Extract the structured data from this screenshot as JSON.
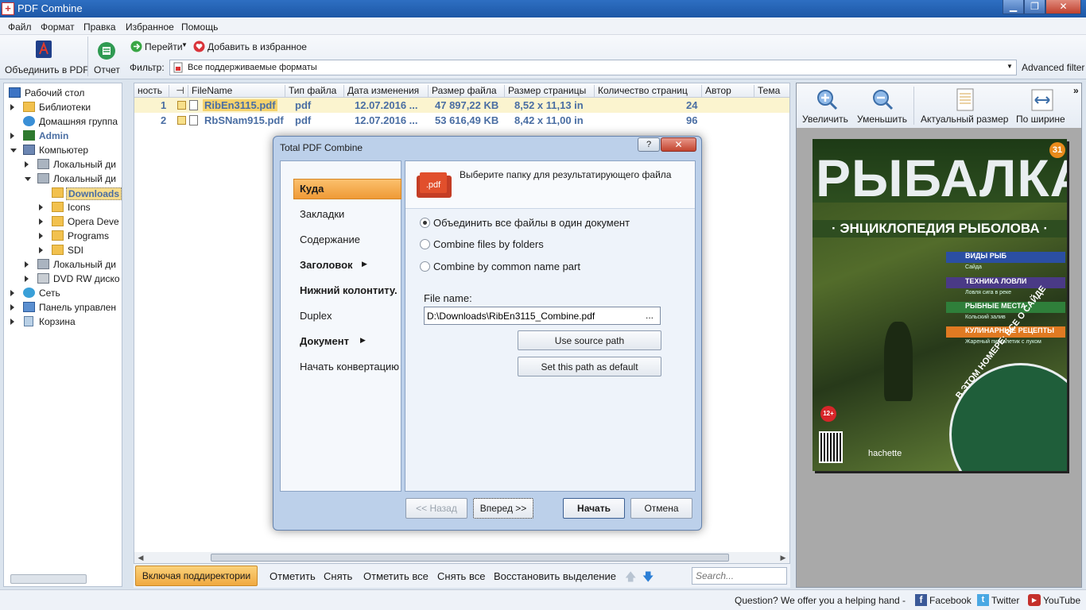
{
  "window": {
    "title": "PDF Combine"
  },
  "menu": [
    "Файл",
    "Формат",
    "Правка",
    "Избранное",
    "Помощь"
  ],
  "toolbar": {
    "combine_label": "Объединить в PDF",
    "report_label": "Отчет",
    "goto_label": "Перейти",
    "favorites_label": "Добавить в избранное",
    "filter_label": "Фильтр:",
    "filter_value": "Все поддерживаемые форматы",
    "advanced_filter": "Advanced filter"
  },
  "tree": [
    {
      "label": "Рабочий стол"
    },
    {
      "label": "Библиотеки"
    },
    {
      "label": "Домашняя группа"
    },
    {
      "label": "Admin"
    },
    {
      "label": "Компьютер"
    },
    {
      "label": "Локальный ди"
    },
    {
      "label": "Локальный ди"
    },
    {
      "label": "Downloads"
    },
    {
      "label": "Icons"
    },
    {
      "label": "Opera Deve"
    },
    {
      "label": "Programs"
    },
    {
      "label": "SDI"
    },
    {
      "label": "Локальный ди"
    },
    {
      "label": "DVD RW диско"
    },
    {
      "label": "Сеть"
    },
    {
      "label": "Панель управлен"
    },
    {
      "label": "Корзина"
    }
  ],
  "filelist": {
    "columns": [
      "ность",
      "FileName",
      "Тип файла",
      "Дата изменения",
      "Размер файла",
      "Размер страницы",
      "Количество страниц",
      "Автор",
      "Тема"
    ],
    "rows": [
      {
        "num": "1",
        "name": "RibEn3115.pdf",
        "type": "pdf",
        "date": "12.07.2016 ...",
        "size": "47 897,22 KB",
        "page_size": "8,52 x 11,13 in",
        "pages": "24"
      },
      {
        "num": "2",
        "name": "RbSNam915.pdf",
        "type": "pdf",
        "date": "12.07.2016 ...",
        "size": "53 616,49 KB",
        "page_size": "8,42 x 11,00 in",
        "pages": "96"
      }
    ]
  },
  "bottombar": {
    "include_sub": "Включая поддиректории",
    "mark": "Отметить",
    "unmark": "Снять",
    "mark_all": "Отметить все",
    "unmark_all": "Снять все",
    "restore": "Восстановить выделение",
    "search_placeholder": "Search..."
  },
  "preview": {
    "zoom_in": "Увеличить",
    "zoom_out": "Уменьшить",
    "actual_size": "Актуальный размер",
    "fit_width": "По ширине",
    "cover_title": "РЫБАЛКА",
    "cover_subtitle": "· ЭНЦИКЛОПЕДИЯ РЫБОЛОВА ·",
    "cover_issue": "31",
    "cover_items": [
      "ВИДЫ РЫБ",
      "Сайда",
      "ТЕХНИКА ЛОВЛИ",
      "Ловля сига в реке",
      "РЫБНЫЕ МЕСТА",
      "Кольский залив",
      "КУЛИНАРНЫЕ РЕЦЕПТЫ",
      "Жареный пистолетик с луком"
    ],
    "cover_banner": "В ЭТОМ НОМЕРЕ: ВСЕ О САЙДЕ",
    "cover_age": "12+",
    "cover_brand": "hachette"
  },
  "dialog": {
    "title": "Total PDF Combine",
    "nav": [
      "Куда",
      "Закладки",
      "Содержание",
      "Заголовок",
      "Нижний колонтиту.",
      "Duplex",
      "Документ",
      "Начать конвертацию"
    ],
    "heading": "Выберите папку для результатирующего файла",
    "pdf_icon": ".pdf",
    "options": [
      "Объединить все файлы в один документ",
      "Combine files by folders",
      "Combine by common name part"
    ],
    "file_name_label": "File name:",
    "file_name_value": "D:\\Downloads\\RibEn3115_Combine.pdf",
    "browse": "...",
    "use_source": "Use source path",
    "set_default": "Set this path as default",
    "back": "<< Назад",
    "next": "Вперед >>",
    "start": "Начать",
    "cancel": "Отмена"
  },
  "status": {
    "question": "Question? We offer you a helping hand -",
    "facebook": "Facebook",
    "twitter": "Twitter",
    "youtube": "YouTube"
  }
}
